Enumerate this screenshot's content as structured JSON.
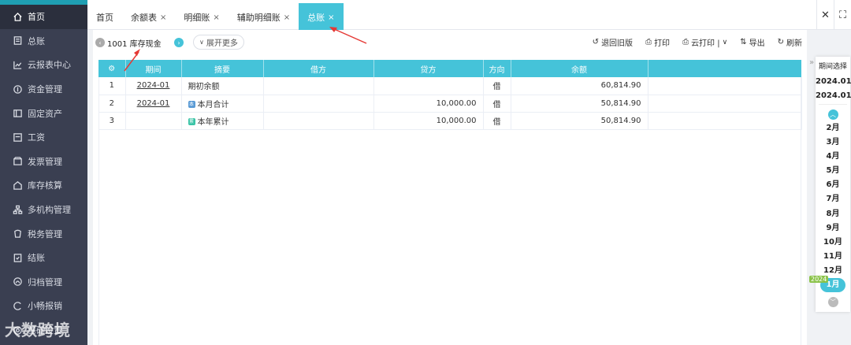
{
  "sidebar": {
    "items": [
      {
        "label": "首页",
        "icon": "home-icon",
        "active": true
      },
      {
        "label": "总账",
        "icon": "ledger-icon"
      },
      {
        "label": "云报表中心",
        "icon": "chart-icon"
      },
      {
        "label": "资金管理",
        "icon": "money-icon"
      },
      {
        "label": "固定资产",
        "icon": "asset-icon"
      },
      {
        "label": "工资",
        "icon": "salary-icon"
      },
      {
        "label": "发票管理",
        "icon": "invoice-icon"
      },
      {
        "label": "库存核算",
        "icon": "warehouse-icon"
      },
      {
        "label": "多机构管理",
        "icon": "org-icon"
      },
      {
        "label": "税务管理",
        "icon": "tax-icon"
      },
      {
        "label": "结账",
        "icon": "close-book-icon"
      },
      {
        "label": "归档管理",
        "icon": "archive-icon"
      },
      {
        "label": "小畅报销",
        "icon": "expense-icon"
      },
      {
        "label": "基础设置",
        "icon": "settings-icon"
      }
    ],
    "watermark": "大数跨境"
  },
  "tabs": [
    {
      "label": "首页",
      "closable": false
    },
    {
      "label": "余额表",
      "closable": true
    },
    {
      "label": "明细账",
      "closable": true
    },
    {
      "label": "辅助明细账",
      "closable": true
    },
    {
      "label": "总账",
      "closable": true,
      "active": true
    }
  ],
  "tab_close_glyph": "×",
  "window": {
    "close_glyph": "✕",
    "fullscreen_glyph": "⛶"
  },
  "toolbar": {
    "account_value": "1001 库存现金",
    "expand_label": "展开更多",
    "actions": [
      {
        "label": "退回旧版",
        "icon": "undo-icon",
        "glyph": "↺"
      },
      {
        "label": "打印",
        "icon": "print-icon",
        "glyph": "⎙"
      },
      {
        "label": "云打印 |",
        "icon": "cloud-print-icon",
        "glyph": "⎙",
        "dropdown": true
      },
      {
        "label": "导出",
        "icon": "export-icon",
        "glyph": "⇅"
      },
      {
        "label": "刷新",
        "icon": "refresh-icon",
        "glyph": "↻"
      }
    ]
  },
  "table": {
    "settings_glyph": "⚙",
    "headers": [
      "期间",
      "摘要",
      "借方",
      "贷方",
      "方向",
      "余额"
    ],
    "rows": [
      {
        "no": "1",
        "period": "2024-01",
        "summary": "期初余额",
        "badge": "",
        "debit": "",
        "credit": "",
        "direction": "借",
        "balance": "60,814.90"
      },
      {
        "no": "2",
        "period": "2024-01",
        "summary": "本月合计",
        "badge": "blue",
        "debit": "",
        "credit": "10,000.00",
        "direction": "借",
        "balance": "50,814.90"
      },
      {
        "no": "3",
        "period": "",
        "summary": "本年累计",
        "badge": "green",
        "debit": "",
        "credit": "10,000.00",
        "direction": "借",
        "balance": "50,814.90"
      }
    ]
  },
  "period_panel": {
    "title": "期间选择",
    "start": "2024.01",
    "end": "2024.01",
    "months": [
      "2月",
      "3月",
      "4月",
      "5月",
      "6月",
      "7月",
      "8月",
      "9月",
      "10月",
      "11月",
      "12月",
      "1月"
    ],
    "active_month": "1月",
    "year_tag": "2024"
  },
  "colors": {
    "accent": "#45c3d9",
    "sidebar": "#3a3f51",
    "arrow": "#e53935"
  }
}
